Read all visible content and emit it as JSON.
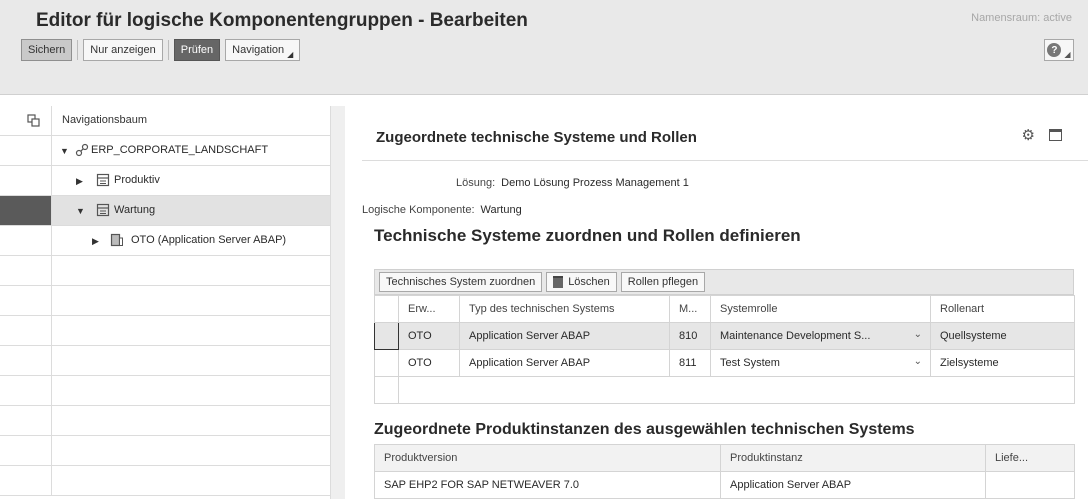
{
  "header": {
    "title": "Editor für logische Komponentengruppen - Bearbeiten",
    "namespace": "Namensraum: active",
    "toolbar": {
      "save": "Sichern",
      "display_only": "Nur anzeigen",
      "check": "Prüfen",
      "navigation": "Navigation"
    },
    "help_icon": "help-icon"
  },
  "nav": {
    "header": "Navigationsbaum",
    "items": [
      {
        "label": "ERP_CORPORATE_LANDSCHAFT",
        "icon": "landscape-icon",
        "expanded": true
      },
      {
        "label": "Produktiv",
        "icon": "folder-icon",
        "expanded": false
      },
      {
        "label": "Wartung",
        "icon": "folder-icon",
        "expanded": true,
        "selected": true
      },
      {
        "label": "OTO (Application Server ABAP)",
        "icon": "system-icon",
        "expanded": false
      }
    ]
  },
  "panel": {
    "title": "Zugeordnete technische Systeme und Rollen",
    "solution_label": "Lösung:",
    "solution_value": "Demo Lösung Prozess Management 1",
    "component_label": "Logische Komponente:",
    "component_value": "Wartung",
    "section1_title": "Technische Systeme zuordnen und Rollen definieren",
    "toolbar": {
      "assign": "Technisches System zuordnen",
      "delete": "Löschen",
      "roles": "Rollen pflegen"
    },
    "systems_table": {
      "headers": [
        "Erw...",
        "Typ des technischen Systems",
        "M...",
        "Systemrolle",
        "Rollenart"
      ],
      "rows": [
        [
          "OTO",
          "Application Server ABAP",
          "810",
          "Maintenance Development S...",
          "Quellsysteme"
        ],
        [
          "OTO",
          "Application Server ABAP",
          "811",
          "Test System",
          "Zielsysteme"
        ]
      ]
    },
    "section2_title": "Zugeordnete Produktinstanzen des ausgewählen technischen Systems",
    "products_table": {
      "headers": [
        "Produktversion",
        "Produktinstanz",
        "Liefe..."
      ],
      "rows": [
        [
          "SAP EHP2 FOR SAP NETWEAVER 7.0",
          "Application Server ABAP",
          ""
        ]
      ]
    }
  }
}
